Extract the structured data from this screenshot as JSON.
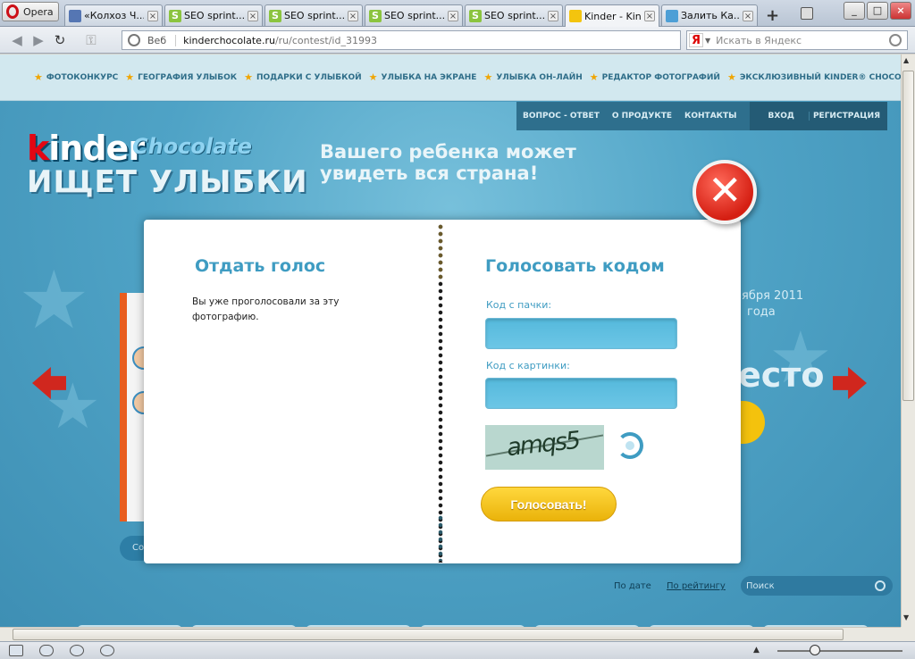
{
  "browser": {
    "app_name": "Opera",
    "tabs": [
      {
        "title": "«Колхоз Ч...",
        "favicon": "kolhoz",
        "active": false
      },
      {
        "title": "SEO sprint....",
        "favicon": "seo",
        "active": false
      },
      {
        "title": "SEO sprint....",
        "favicon": "seo",
        "active": false
      },
      {
        "title": "SEO sprint....",
        "favicon": "seo",
        "active": false
      },
      {
        "title": "SEO sprint....",
        "favicon": "seo",
        "active": false
      },
      {
        "title": "Kinder - Kin...",
        "favicon": "kinder",
        "active": true
      },
      {
        "title": "Залить Ка...",
        "favicon": "zalit",
        "active": false
      }
    ],
    "address": {
      "veb_label": "Веб",
      "host": "kinderchocolate.ru",
      "path": "/ru/contest/id_31993"
    },
    "search_placeholder": "Искать в Яндекс",
    "search_engine_glyph": "Я"
  },
  "site": {
    "top_menu": [
      "ФОТОКОНКУРС",
      "ГЕОГРАФИЯ УЛЫБОК",
      "ПОДАРКИ С УЛЫБКОЙ",
      "УЛЫБКА НА ЭКРАНЕ",
      "УЛЫБКА ОН-ЛАЙН",
      "РЕДАКТОР ФОТОГРАФИЙ",
      "ЭКСКЛЮЗИВНЫЙ KINDER® CHOCOLATE"
    ],
    "site_nav": [
      "ВОПРОС - ОТВЕТ",
      "О ПРОДУКТЕ",
      "КОНТАКТЫ"
    ],
    "auth_nav": [
      "ВХОД",
      "РЕГИСТРАЦИЯ"
    ],
    "logo": {
      "brand_k": "k",
      "brand_rest": "inder",
      "chocolate": "Chocolate",
      "slogan": "ИЩЕТ УЛЫБКИ"
    },
    "tagline_line1": "Вашего ребенка может",
    "tagline_line2": "увидеть вся страна!",
    "date_partial1": "ября 2011",
    "date_partial2": "года",
    "mesto_partial": "есто",
    "left_button_partial": "Со",
    "sort": {
      "by_date": "По дате",
      "by_rating": "По рейтингу"
    },
    "site_search_placeholder": "Поиск"
  },
  "modal": {
    "left_title": "Отдать голос",
    "left_message": "Вы уже проголосовали за эту фотографию.",
    "right_title": "Голосовать кодом",
    "pack_code_label": "Код с пачки:",
    "pack_code_value": "",
    "image_code_label": "Код с картинки:",
    "image_code_value": "",
    "captcha_text": "amqs5",
    "vote_button": "Голосовать!"
  },
  "colors": {
    "accent": "#3f9cc2",
    "close_red": "#d51f13",
    "button_yellow": "#f4c20d"
  }
}
